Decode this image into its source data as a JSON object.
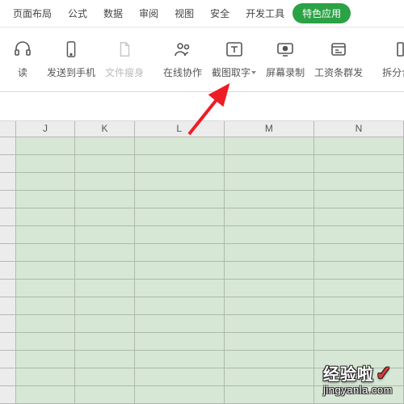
{
  "menu": {
    "items": [
      "页面布局",
      "公式",
      "数据",
      "审阅",
      "视图",
      "安全",
      "开发工具"
    ],
    "active": "特色应用"
  },
  "toolbar": {
    "read": "读",
    "send_phone": "发送到手机",
    "file_slim": "文件瘦身",
    "online_collab": "在线协作",
    "screenshot_ocr": "截图取字",
    "screen_record": "屏幕录制",
    "payroll_send": "工资条群发",
    "split_merge": "拆分合并"
  },
  "columns": [
    "J",
    "K",
    "L",
    "M",
    "N"
  ],
  "column_widths": [
    "ksz",
    "ksz",
    "big",
    "big",
    "big"
  ],
  "rows_count": 15,
  "watermark": {
    "title": "经验啦",
    "url": "jingyanla.com"
  }
}
